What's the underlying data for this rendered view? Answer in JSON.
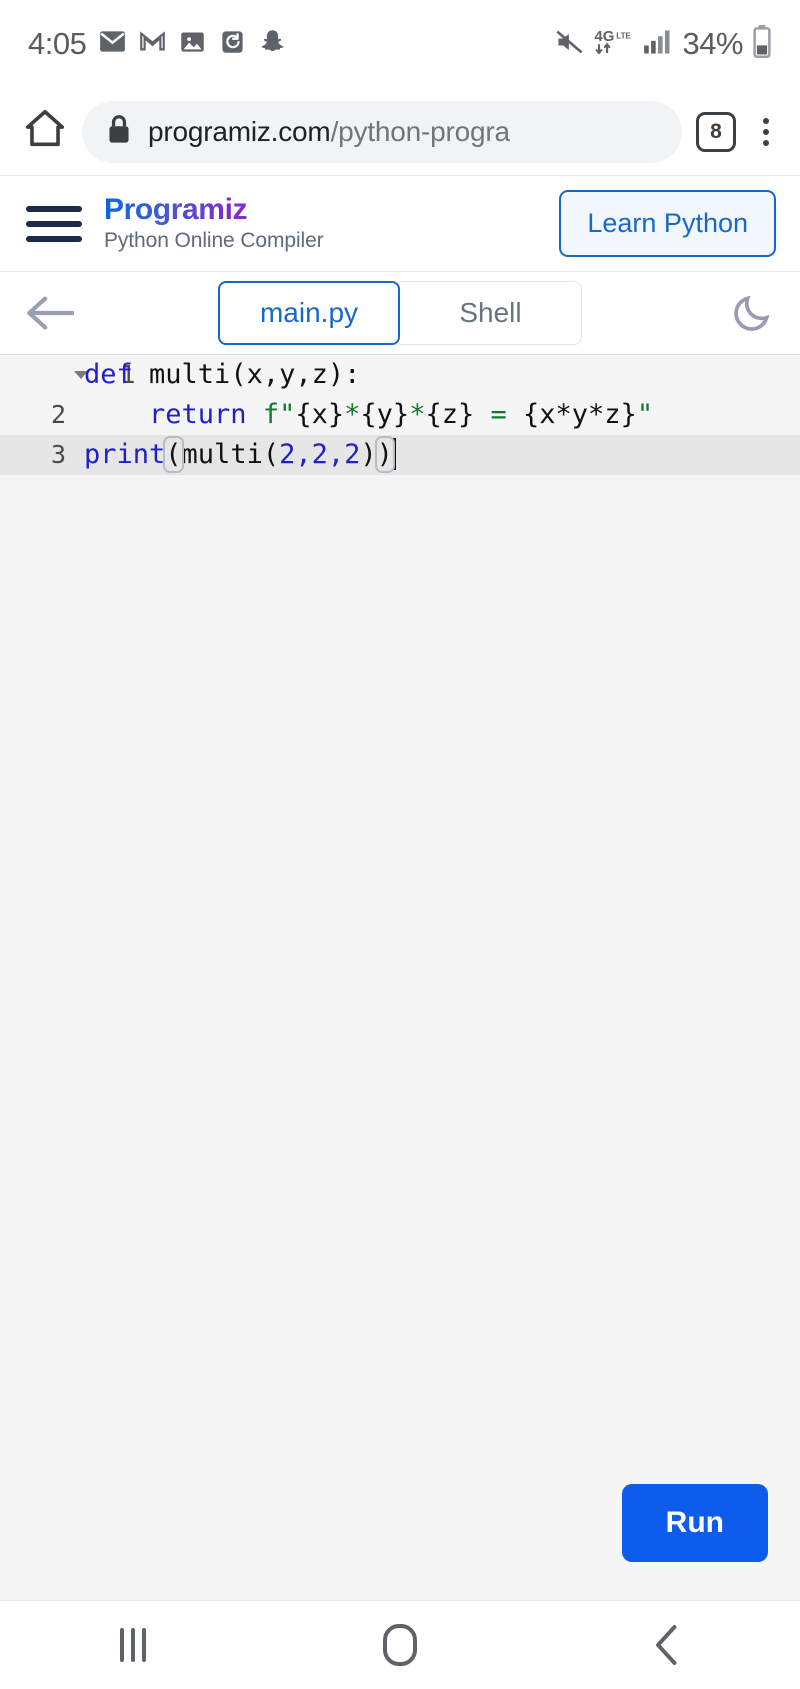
{
  "status_bar": {
    "time": "4:05",
    "battery_percent": "34%",
    "network_type": "4G",
    "network_sub": "LTE",
    "icons": [
      {
        "name": "email-icon",
        "label": "Email"
      },
      {
        "name": "gmail-icon",
        "label": "Gmail"
      },
      {
        "name": "gallery-icon",
        "label": "Gallery"
      },
      {
        "name": "clock-refresh-icon",
        "label": "Clock"
      },
      {
        "name": "snapchat-icon",
        "label": "Snapchat"
      }
    ],
    "right_icons": [
      {
        "name": "mute-icon",
        "label": "Muted"
      },
      {
        "name": "signal-icon",
        "label": "Signal"
      },
      {
        "name": "battery-icon",
        "label": "Battery"
      }
    ]
  },
  "browser": {
    "home_icon": "home-icon",
    "lock_icon": "lock-icon",
    "url_domain": "programiz.com",
    "url_path": "/python-progra",
    "tab_count": "8",
    "menu_icon": "kebab-menu-icon"
  },
  "site_header": {
    "menu_icon": "hamburger-icon",
    "brand": "Programiz",
    "subtitle": "Python Online Compiler",
    "cta_label": "Learn Python",
    "cta_color": "#1868c9"
  },
  "editor_tabs": {
    "back_icon": "back-arrow-icon",
    "theme_icon": "moon-icon",
    "tabs": [
      {
        "label": "main.py",
        "active": true
      },
      {
        "label": "Shell",
        "active": false
      }
    ]
  },
  "code": {
    "lines": [
      {
        "number": "1",
        "foldable": true,
        "active": false
      },
      {
        "number": "2",
        "foldable": false,
        "active": false
      },
      {
        "number": "3",
        "foldable": false,
        "active": true
      }
    ],
    "line1": {
      "kw": "def",
      "rest": " multi(x,y,z):"
    },
    "line2": {
      "indent": "    ",
      "kw": "return",
      "space": " ",
      "fstring_prefix": "f\"",
      "body_a": "{x}",
      "star_a": "*",
      "body_b": "{y}",
      "star_b": "*",
      "body_c": "{z}",
      "eq": " = ",
      "body_d": "{x*y*z}",
      "quote_end": "\""
    },
    "line3": {
      "fn": "print",
      "open": "(",
      "inner_fn": "multi(",
      "args": "2,2,2",
      "close_inner": ")",
      "close_outer": ")"
    },
    "plain_text": "def multi(x,y,z):\n    return f\"{x}*{y}*{z} = {x*y*z}\"\nprint(multi(2,2,2))"
  },
  "run": {
    "label": "Run",
    "color": "#0d5ceb"
  },
  "android_nav": {
    "recents": "recents-icon",
    "home": "home-icon",
    "back": "back-icon"
  }
}
